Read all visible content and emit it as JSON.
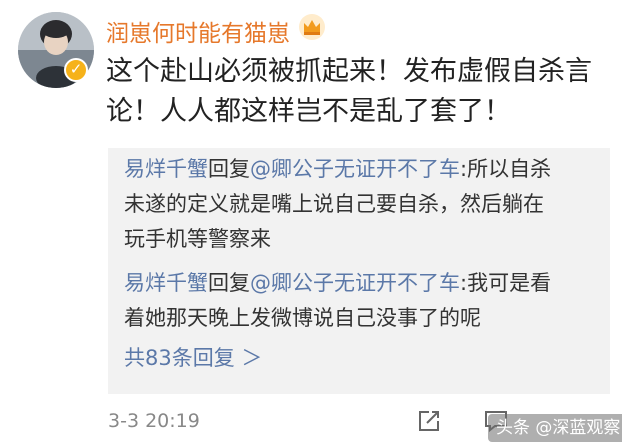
{
  "post": {
    "username": "润崽何时能有猫崽",
    "body_lines": [
      "这个赴山必须被抓起来！发布虚假自杀言",
      "论！人人都这样岂不是乱了套了！"
    ],
    "timestamp": "3-3 20:19"
  },
  "replies": [
    {
      "author": "易烊千蟹",
      "reply_word": "回复",
      "target": "@卿公子无证开不了车",
      "separator": ":",
      "lines": [
        "所以自杀",
        "未遂的定义就是嘴上说自己要自杀，然后躺在",
        "玩手机等警察来"
      ]
    },
    {
      "author": "易烊千蟹",
      "reply_word": "回复",
      "target": "@卿公子无证开不了车",
      "separator": ":",
      "lines": [
        "我可是看",
        "着她那天晚上发微博说自己没事了的呢"
      ]
    }
  ],
  "more_replies": "共83条回复 ＞",
  "watermark": "头条 @深蓝观察",
  "colors": {
    "username": "#e6782b",
    "link": "#5b78a8",
    "reply_bg": "#f2f2f2",
    "badge": "#f6b21a"
  },
  "icons": [
    "crown-icon",
    "verified-badge-icon",
    "share-icon",
    "comment-icon"
  ]
}
